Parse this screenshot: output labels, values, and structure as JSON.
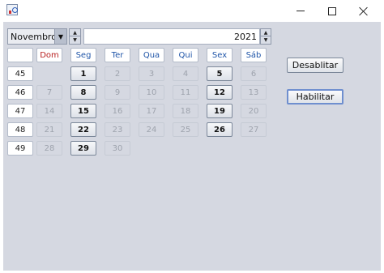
{
  "window": {
    "controls": {
      "minimize": "minimize-icon",
      "maximize": "maximize-icon",
      "close": "close-icon"
    }
  },
  "calendar": {
    "month": "Novembro",
    "year": "2021",
    "weekdays": [
      "Dom",
      "Seg",
      "Ter",
      "Qua",
      "Qui",
      "Sex",
      "Sáb"
    ],
    "weeks": [
      {
        "week": "45",
        "days": [
          "",
          "1",
          "2",
          "3",
          "4",
          "5",
          "6"
        ]
      },
      {
        "week": "46",
        "days": [
          "7",
          "8",
          "9",
          "10",
          "11",
          "12",
          "13"
        ]
      },
      {
        "week": "47",
        "days": [
          "14",
          "15",
          "16",
          "17",
          "18",
          "19",
          "20"
        ]
      },
      {
        "week": "48",
        "days": [
          "21",
          "22",
          "23",
          "24",
          "25",
          "26",
          "27"
        ]
      },
      {
        "week": "49",
        "days": [
          "28",
          "29",
          "30",
          "",
          "",
          "",
          ""
        ]
      }
    ],
    "enabled_days": [
      "1",
      "5",
      "8",
      "12",
      "15",
      "19",
      "22",
      "26",
      "29"
    ],
    "colors": {
      "weekday_header": "#1f55a8",
      "sunday_header": "#b82020"
    }
  },
  "buttons": {
    "disable": "Desablitar",
    "enable": "Habilitar"
  }
}
